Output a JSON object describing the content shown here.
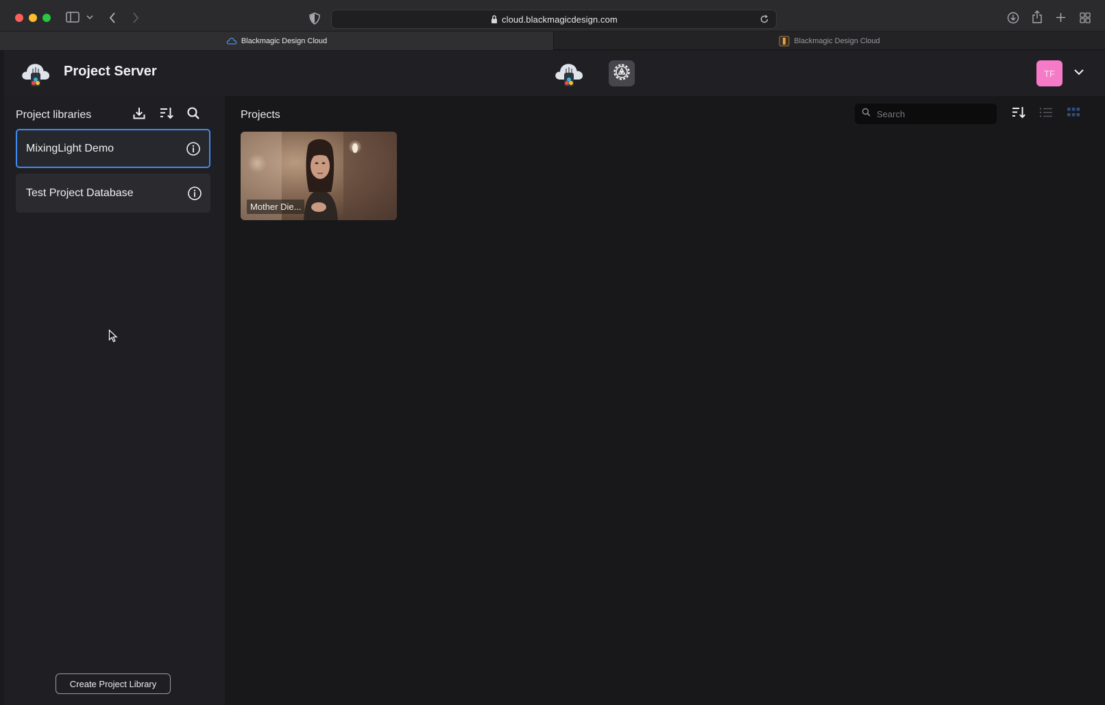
{
  "browser": {
    "url": "cloud.blackmagicdesign.com",
    "tabs": [
      {
        "label": "Blackmagic Design Cloud",
        "active": true,
        "icon": "cloud-icon"
      },
      {
        "label": "Blackmagic Design Cloud",
        "active": false,
        "icon": "page-icon"
      }
    ]
  },
  "header": {
    "title": "Project Server",
    "avatar_initials": "TF",
    "avatar_color": "#f57ac8"
  },
  "sidebar": {
    "title": "Project libraries",
    "libraries": [
      {
        "label": "MixingLight Demo",
        "selected": true
      },
      {
        "label": "Test Project Database",
        "selected": false
      }
    ],
    "create_button": "Create Project Library"
  },
  "main": {
    "title": "Projects",
    "search_placeholder": "Search",
    "view_mode": "grid",
    "projects": [
      {
        "name": "Mother Die..."
      }
    ]
  },
  "colors": {
    "accent": "#3f8cf2",
    "background": "#18181a",
    "sidebar": "#1f1f23"
  }
}
